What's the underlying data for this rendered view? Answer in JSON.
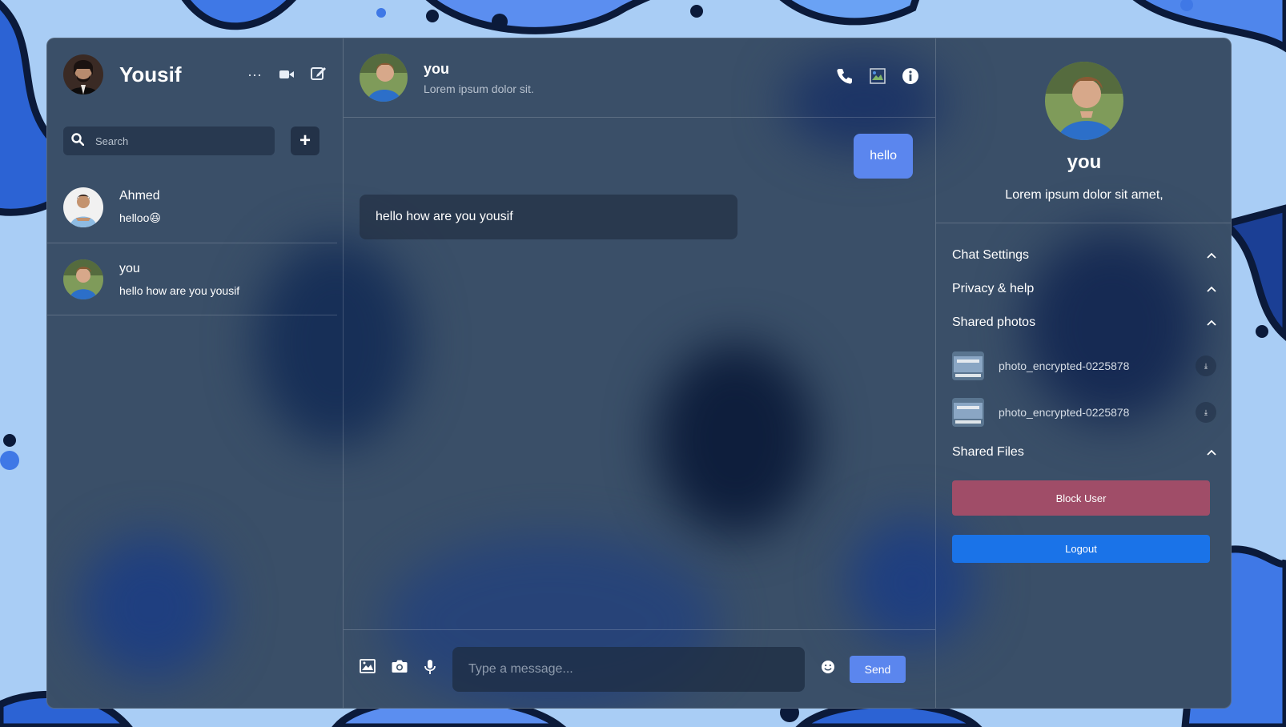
{
  "current_user": {
    "name": "Yousif"
  },
  "header_icons": [
    "more-icon",
    "video-icon",
    "edit-icon"
  ],
  "search": {
    "placeholder": "Search"
  },
  "chats": [
    {
      "name": "Ahmed",
      "last_message": "helloo😆"
    },
    {
      "name": "you",
      "last_message": "hello how are you yousif"
    }
  ],
  "conversation": {
    "name": "you",
    "status": "Lorem ipsum dolor sit.",
    "messages": [
      {
        "from": "own",
        "text": "hello"
      },
      {
        "from": "other",
        "text": "hello how are you yousif"
      }
    ],
    "input_placeholder": "Type a message...",
    "send_label": "Send"
  },
  "profile": {
    "name": "you",
    "description": "Lorem ipsum dolor sit amet,"
  },
  "options": {
    "chat_settings": "Chat Settings",
    "privacy_help": "Privacy & help",
    "shared_photos": "Shared photos",
    "shared_files": "Shared Files"
  },
  "shared_photos": [
    {
      "name": "photo_encrypted-0225878"
    },
    {
      "name": "photo_encrypted-0225878"
    }
  ],
  "buttons": {
    "block": "Block User",
    "logout": "Logout"
  },
  "colors": {
    "accent": "#5b86ee",
    "block": "#a04d68",
    "logout": "#1a73e8",
    "panel": "#3a4f68"
  }
}
